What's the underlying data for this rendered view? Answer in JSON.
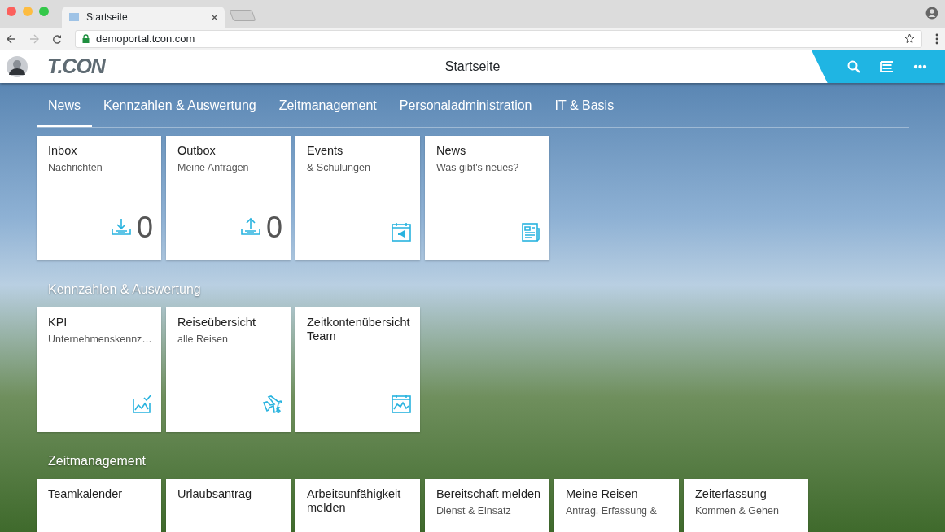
{
  "browser": {
    "tab_title": "Startseite",
    "url": "demoportal.tcon.com"
  },
  "header": {
    "logo": "T.CON",
    "title": "Startseite"
  },
  "nav_tabs": [
    {
      "label": "News",
      "selected": true
    },
    {
      "label": "Kennzahlen & Auswertung",
      "selected": false
    },
    {
      "label": "Zeitmanagement",
      "selected": false
    },
    {
      "label": "Personaladministration",
      "selected": false
    },
    {
      "label": "IT & Basis",
      "selected": false
    }
  ],
  "groups": [
    {
      "tiles": [
        {
          "title": "Inbox",
          "subtitle": "Nachrichten",
          "kind": "inbox",
          "count": "0"
        },
        {
          "title": "Outbox",
          "subtitle": "Meine Anfragen",
          "kind": "outbox",
          "count": "0"
        },
        {
          "title": "Events",
          "subtitle": "& Schulungen",
          "kind": "event"
        },
        {
          "title": "News",
          "subtitle": "Was gibt's neues?",
          "kind": "news"
        }
      ]
    },
    {
      "heading": "Kennzahlen & Auswertung",
      "tiles": [
        {
          "title": "KPI",
          "subtitle": "Unternehmenskennz…",
          "kind": "kpi"
        },
        {
          "title": "Reiseübersicht",
          "subtitle": "alle Reisen",
          "kind": "travel"
        },
        {
          "title": "Zeitkontenübersicht Team",
          "kind": "timeaccount"
        }
      ]
    },
    {
      "heading": "Zeitmanagement",
      "tiles": [
        {
          "title": "Teamkalender"
        },
        {
          "title": "Urlaubsantrag"
        },
        {
          "title": "Arbeitsunfähigkeit melden"
        },
        {
          "title": "Bereitschaft melden",
          "subtitle": "Dienst & Einsatz"
        },
        {
          "title": "Meine Reisen",
          "subtitle": "Antrag, Erfassung &"
        },
        {
          "title": "Zeiterfassung",
          "subtitle": "Kommen & Gehen"
        }
      ]
    }
  ]
}
